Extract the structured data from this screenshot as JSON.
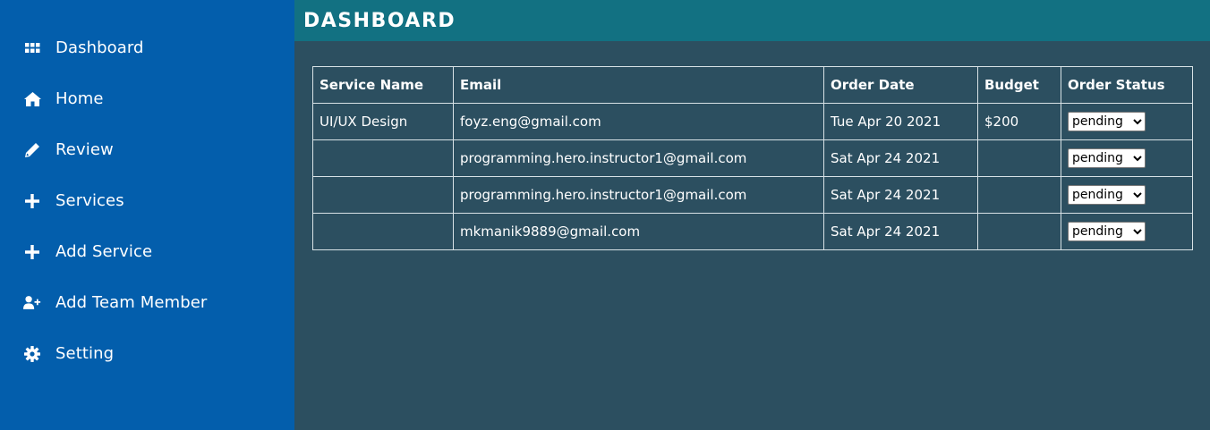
{
  "sidebar": {
    "items": [
      {
        "label": "Dashboard",
        "icon": "grid-icon"
      },
      {
        "label": "Home",
        "icon": "home-icon"
      },
      {
        "label": "Review",
        "icon": "pencil-icon"
      },
      {
        "label": "Services",
        "icon": "plus-icon"
      },
      {
        "label": "Add Service",
        "icon": "plus-icon"
      },
      {
        "label": "Add Team Member",
        "icon": "user-plus-icon"
      },
      {
        "label": "Setting",
        "icon": "gear-icon"
      }
    ]
  },
  "header": {
    "title": "DASHBOARD"
  },
  "orders": {
    "columns": [
      "Service Name",
      "Email",
      "Order Date",
      "Budget",
      "Order Status"
    ],
    "status_options": [
      "pending"
    ],
    "rows": [
      {
        "service": "UI/UX Design",
        "email": "foyz.eng@gmail.com",
        "date": "Tue Apr 20 2021",
        "budget": "$200",
        "status": "pending"
      },
      {
        "service": "",
        "email": "programming.hero.instructor1@gmail.com",
        "date": "Sat Apr 24 2021",
        "budget": "",
        "status": "pending"
      },
      {
        "service": "",
        "email": "programming.hero.instructor1@gmail.com",
        "date": "Sat Apr 24 2021",
        "budget": "",
        "status": "pending"
      },
      {
        "service": "",
        "email": "mkmanik9889@gmail.com",
        "date": "Sat Apr 24 2021",
        "budget": "",
        "status": "pending"
      }
    ]
  },
  "colors": {
    "sidebar_bg": "#035eac",
    "topbar_bg": "#127182",
    "main_bg": "#2c4f60"
  }
}
